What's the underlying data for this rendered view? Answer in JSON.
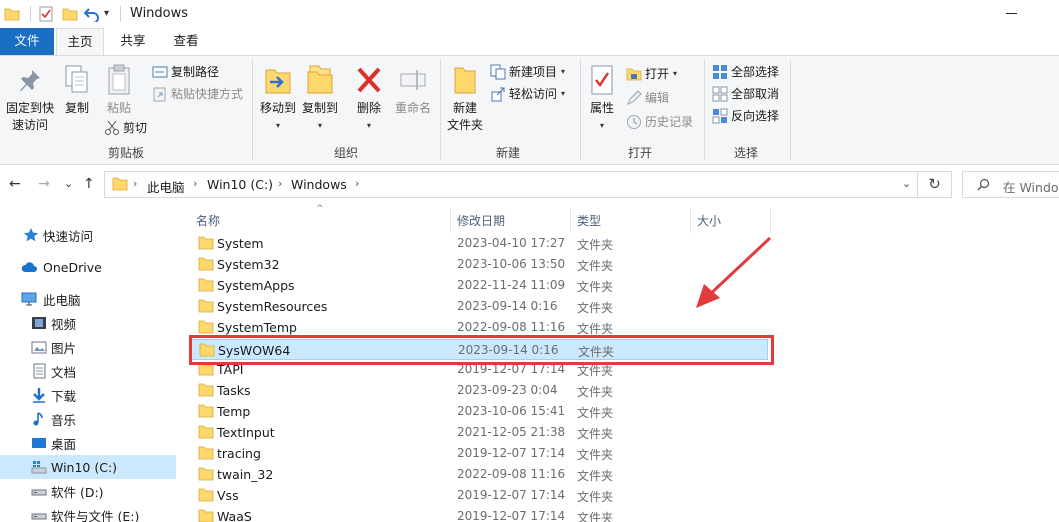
{
  "window": {
    "title": "Windows"
  },
  "quick_access_toolbar": {
    "icons": [
      "folder-icon",
      "properties-icon",
      "new-folder-icon",
      "undo-icon",
      "customize-dropdown-icon"
    ],
    "more_glyph": "▾"
  },
  "ribbon_tabs": [
    {
      "label": "文件",
      "active": false
    },
    {
      "label": "主页",
      "active": true
    },
    {
      "label": "共享",
      "active": false
    },
    {
      "label": "查看",
      "active": false
    }
  ],
  "ribbon": {
    "clipboard": {
      "group_label": "剪贴板",
      "pin_label_1": "固定到快",
      "pin_label_2": "速访问",
      "copy_label": "复制",
      "paste_label": "粘贴",
      "copy_path_label": "复制路径",
      "paste_shortcut_label": "粘贴快捷方式",
      "cut_label": "剪切"
    },
    "organize": {
      "group_label": "组织",
      "move_to_label": "移动到",
      "copy_to_label": "复制到",
      "delete_label": "删除",
      "rename_label": "重命名"
    },
    "new": {
      "group_label": "新建",
      "new_folder_label_1": "新建",
      "new_folder_label_2": "文件夹",
      "new_item_label": "新建项目",
      "easy_access_label": "轻松访问"
    },
    "open": {
      "group_label": "打开",
      "properties_label": "属性",
      "open_label": "打开",
      "edit_label": "编辑",
      "history_label": "历史记录"
    },
    "select": {
      "group_label": "选择",
      "select_all_label": "全部选择",
      "select_none_label": "全部取消",
      "invert_label": "反向选择"
    }
  },
  "address_bar": {
    "breadcrumbs": [
      "此电脑",
      "Win10 (C:)",
      "Windows"
    ],
    "separator": "›",
    "dropdown_glyph": "⌄",
    "refresh_glyph": "↻"
  },
  "search": {
    "placeholder": "在 Windo"
  },
  "nav_buttons": {
    "back": "←",
    "forward": "→",
    "recent": "⌄",
    "up": "↑"
  },
  "nav_pane": [
    {
      "label": "快速访问",
      "icon": "star-icon"
    },
    {
      "label": "OneDrive",
      "icon": "cloud-icon"
    },
    {
      "label": "此电脑",
      "icon": "computer-icon"
    },
    {
      "label": "视频",
      "icon": "video-icon"
    },
    {
      "label": "图片",
      "icon": "pictures-icon"
    },
    {
      "label": "文档",
      "icon": "documents-icon"
    },
    {
      "label": "下载",
      "icon": "download-icon"
    },
    {
      "label": "音乐",
      "icon": "music-icon"
    },
    {
      "label": "桌面",
      "icon": "desktop-icon"
    },
    {
      "label": "Win10 (C:)",
      "icon": "drive-c-icon",
      "selected": true
    },
    {
      "label": "软件 (D:)",
      "icon": "drive-d-icon"
    },
    {
      "label": "软件与文件 (E:)",
      "icon": "drive-e-icon"
    }
  ],
  "columns": {
    "name": "名称",
    "modified": "修改日期",
    "type": "类型",
    "size": "大小",
    "sort_glyph": "^"
  },
  "files": [
    {
      "name": "System",
      "date": "2023-04-10 17:27",
      "type": "文件夹"
    },
    {
      "name": "System32",
      "date": "2023-10-06 13:50",
      "type": "文件夹"
    },
    {
      "name": "SystemApps",
      "date": "2022-11-24 11:09",
      "type": "文件夹"
    },
    {
      "name": "SystemResources",
      "date": "2023-09-14 0:16",
      "type": "文件夹"
    },
    {
      "name": "SystemTemp",
      "date": "2022-09-08 11:16",
      "type": "文件夹"
    },
    {
      "name": "SysWOW64",
      "date": "2023-09-14 0:16",
      "type": "文件夹",
      "selected": true
    },
    {
      "name": "TAPI",
      "date": "2019-12-07 17:14",
      "type": "文件夹"
    },
    {
      "name": "Tasks",
      "date": "2023-09-23 0:04",
      "type": "文件夹"
    },
    {
      "name": "Temp",
      "date": "2023-10-06 15:41",
      "type": "文件夹"
    },
    {
      "name": "TextInput",
      "date": "2021-12-05 21:38",
      "type": "文件夹"
    },
    {
      "name": "tracing",
      "date": "2019-12-07 17:14",
      "type": "文件夹"
    },
    {
      "name": "twain_32",
      "date": "2022-09-08 11:16",
      "type": "文件夹"
    },
    {
      "name": "Vss",
      "date": "2019-12-07 17:14",
      "type": "文件夹"
    },
    {
      "name": "WaaS",
      "date": "2019-12-07 17:14",
      "type": "文件夹"
    }
  ],
  "colors": {
    "accent": "#1a6fc4",
    "selection": "#cce8ff",
    "annotation_red": "#e23b3b",
    "folder_yellow": "#ffd86b"
  }
}
